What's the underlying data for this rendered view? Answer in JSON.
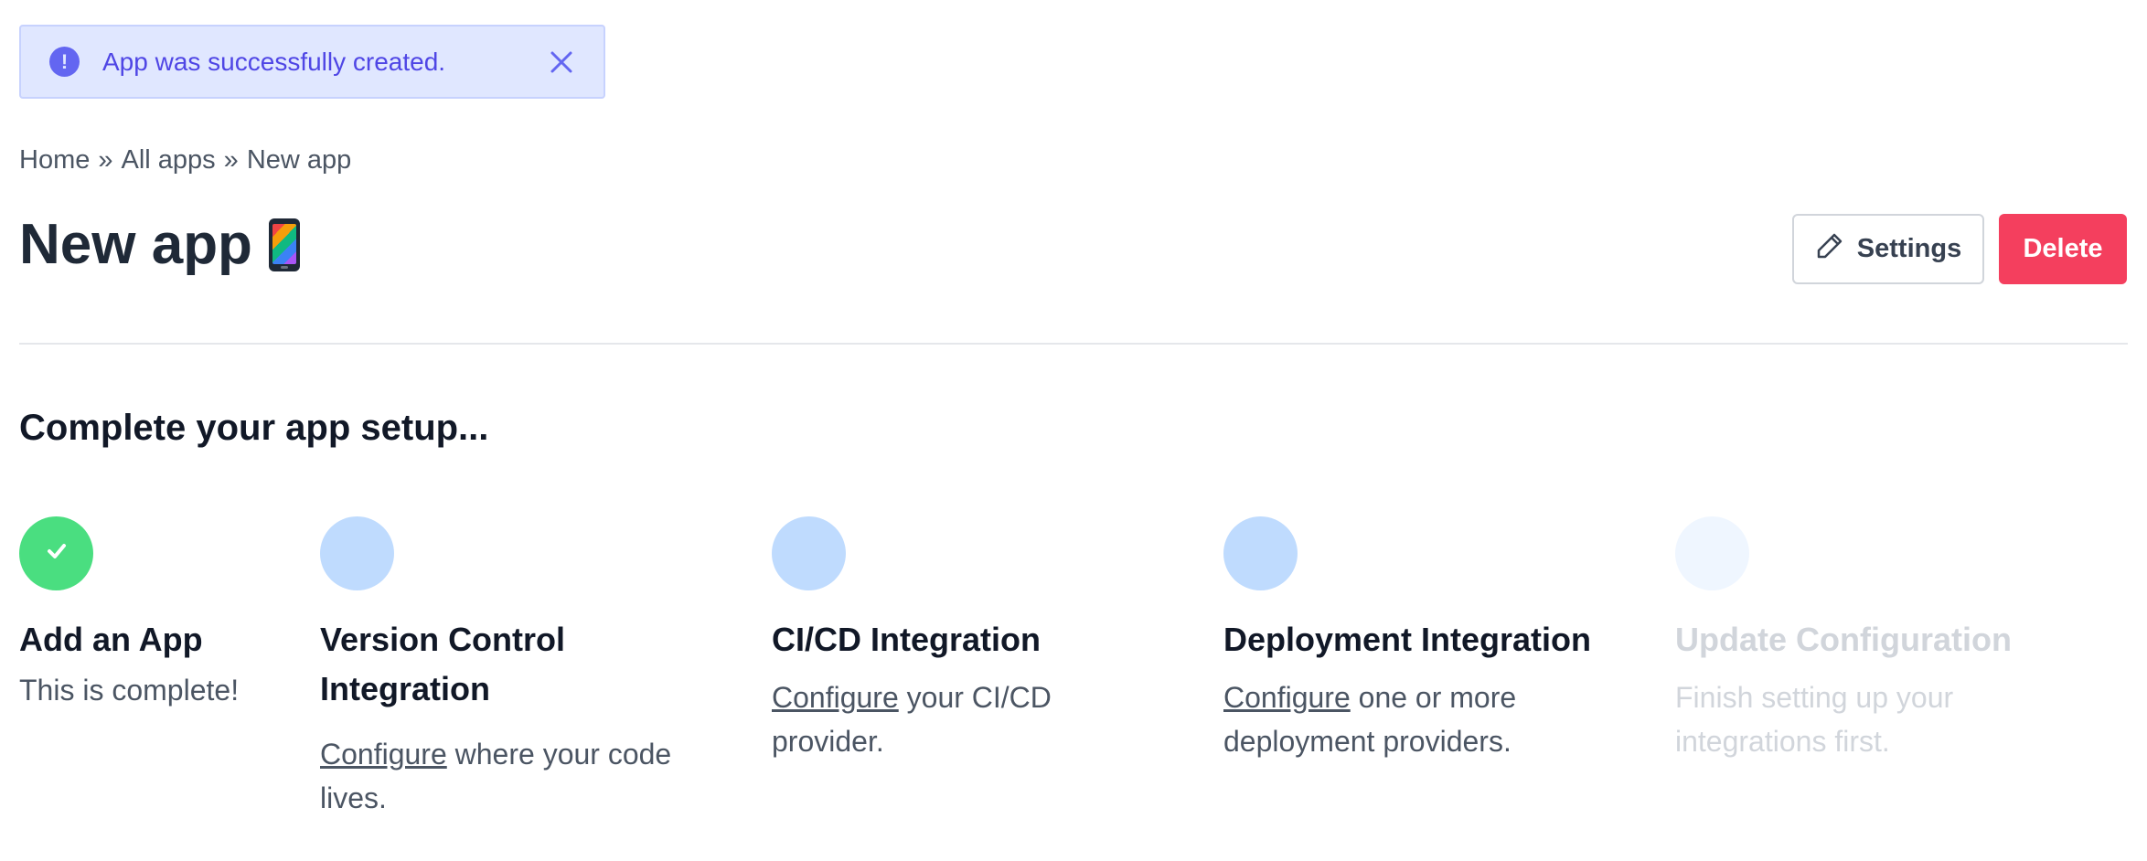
{
  "alert": {
    "message": "App was successfully created.",
    "icon": "exclamation-icon",
    "close_icon": "close-icon",
    "colors": {
      "background": "#e0e7ff",
      "text": "#4f46e5"
    }
  },
  "breadcrumb": {
    "items": [
      "Home",
      "All apps",
      "New app"
    ],
    "separator": "»"
  },
  "header": {
    "title": "New app",
    "title_icon": "mobile-phone-icon",
    "settings_label": "Settings",
    "settings_icon": "pencil-icon",
    "delete_label": "Delete",
    "delete_color": "#f43f5e"
  },
  "setup": {
    "heading": "Complete your app setup...",
    "steps": [
      {
        "title": "Add an App",
        "desc": "This is complete!",
        "status": "done"
      },
      {
        "title": "Version Control Integration",
        "link": "Configure",
        "desc": "where your code lives.",
        "status": "todo"
      },
      {
        "title": "CI/CD Integration",
        "link": "Configure",
        "desc": "your CI/CD provider.",
        "status": "todo"
      },
      {
        "title": "Deployment Integration",
        "link": "Configure",
        "desc": "one or more deployment providers.",
        "status": "todo"
      },
      {
        "title": "Update Configuration",
        "desc": "Finish setting up your integrations first.",
        "status": "locked"
      }
    ]
  }
}
